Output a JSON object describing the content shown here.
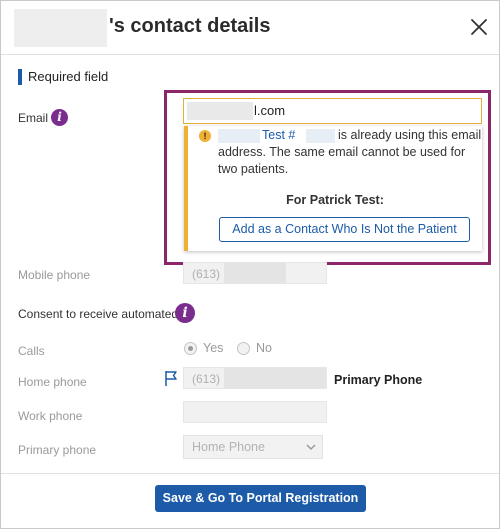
{
  "header": {
    "title": "'s contact details",
    "close_icon": "close-icon"
  },
  "required": {
    "label": "Required field"
  },
  "email": {
    "label": "Email",
    "info_icon": "info-icon",
    "value_suffix": "l.com",
    "warning": {
      "icon": "warning-icon",
      "link_text": "Test #",
      "line1": "is already using this email",
      "line2": "address. The same email cannot be used for",
      "line3": "two patients.",
      "for_text": "For Patrick Test:",
      "button_label": "Add as a Contact Who Is Not the Patient"
    }
  },
  "mobile_phone": {
    "label": "Mobile phone",
    "value": "(613)"
  },
  "consent": {
    "label": "Consent to receive automated:",
    "info_icon": "info-icon"
  },
  "calls": {
    "label": "Calls",
    "options": [
      "Yes",
      "No"
    ],
    "selected": "Yes"
  },
  "home_phone": {
    "label": "Home phone",
    "value": "(613)",
    "flag_icon": "flag-icon",
    "primary_label": "Primary Phone"
  },
  "work_phone": {
    "label": "Work phone",
    "value": ""
  },
  "primary_phone": {
    "label": "Primary phone",
    "selected": "Home Phone"
  },
  "footer": {
    "save_label": "Save & Go To Portal Registration"
  },
  "colors": {
    "accent": "#1d5ba8",
    "info": "#7b2d8e",
    "warning": "#f0b033",
    "highlight": "#8b2668"
  }
}
